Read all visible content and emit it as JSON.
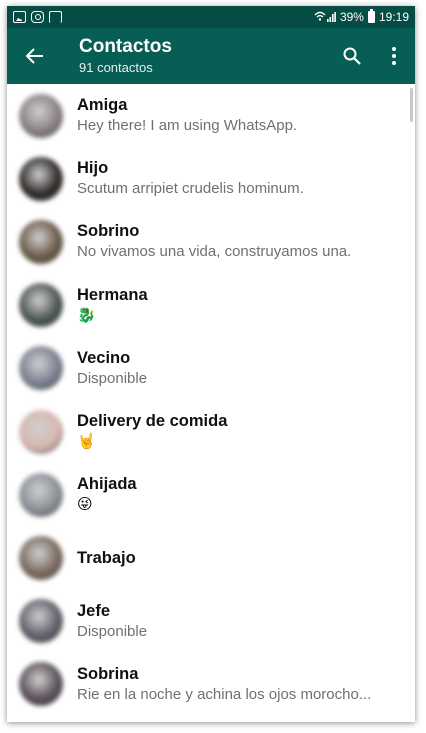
{
  "statusbar": {
    "left_icons": [
      "image-icon",
      "instagram-icon",
      "cast-icon"
    ],
    "signal": "wifi-signal-icon",
    "battery_percent": "39%",
    "time": "19:19"
  },
  "appbar": {
    "title": "Contactos",
    "subtitle": "91 contactos",
    "back_icon": "arrow-back-icon",
    "search_icon": "search-icon",
    "menu_icon": "more-vert-icon"
  },
  "contacts": [
    {
      "name": "Amiga",
      "status": "Hey there! I am using WhatsApp.",
      "avatar_color": "#8a7f86"
    },
    {
      "name": "Hijo",
      "status": "Scutum arripiet crudelis hominum.",
      "avatar_color": "#2e2a28"
    },
    {
      "name": "Sobrino",
      "status": "No vivamos una vida, construyamos una.",
      "avatar_color": "#6a5a48"
    },
    {
      "name": "Hermana",
      "status": "🐉",
      "avatar_color": "#4a5550"
    },
    {
      "name": "Vecino",
      "status": "Disponible",
      "avatar_color": "#7a8090"
    },
    {
      "name": "Delivery de comida",
      "status": "🤘",
      "avatar_color": "#d8b8b0"
    },
    {
      "name": "Ahijada",
      "status": "😜",
      "avatar_color": "#8a8f96"
    },
    {
      "name": "Trabajo",
      "status": "",
      "avatar_color": "#7a6a5f"
    },
    {
      "name": "Jefe",
      "status": "Disponible",
      "avatar_color": "#5f5f6a"
    },
    {
      "name": "Sobrina",
      "status": "Rie en la noche y achina los ojos morocho...",
      "avatar_color": "#5a4f58"
    }
  ]
}
